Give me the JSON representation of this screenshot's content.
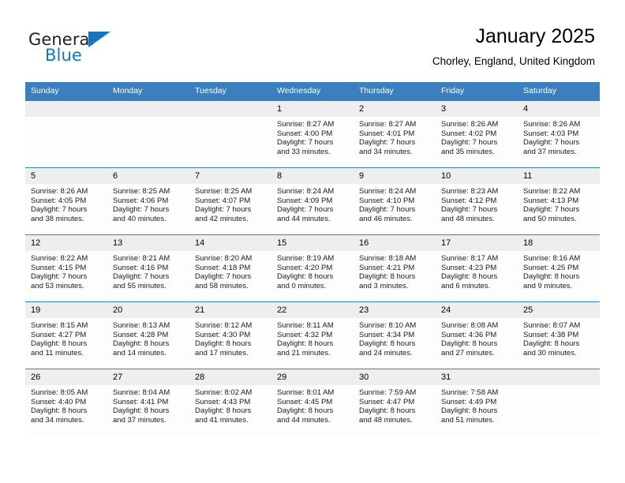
{
  "brand": {
    "name_part1": "General",
    "name_part2": "Blue",
    "triangle_color": "#1675bb"
  },
  "header": {
    "month_title": "January 2025",
    "location": "Chorley, England, United Kingdom",
    "header_bg": "#3b7fbf",
    "daynum_bg": "#eeeeee"
  },
  "weekdays": [
    "Sunday",
    "Monday",
    "Tuesday",
    "Wednesday",
    "Thursday",
    "Friday",
    "Saturday"
  ],
  "labels": {
    "sunrise_prefix": "Sunrise:",
    "sunset_prefix": "Sunset:",
    "daylight_prefix": "Daylight:"
  },
  "weeks": [
    [
      {
        "day": "",
        "empty": true
      },
      {
        "day": "",
        "empty": true
      },
      {
        "day": "",
        "empty": true
      },
      {
        "day": "1",
        "sunrise": "Sunrise: 8:27 AM",
        "sunset": "Sunset: 4:00 PM",
        "daylight_line1": "Daylight: 7 hours",
        "daylight_line2": "and 33 minutes."
      },
      {
        "day": "2",
        "sunrise": "Sunrise: 8:27 AM",
        "sunset": "Sunset: 4:01 PM",
        "daylight_line1": "Daylight: 7 hours",
        "daylight_line2": "and 34 minutes."
      },
      {
        "day": "3",
        "sunrise": "Sunrise: 8:26 AM",
        "sunset": "Sunset: 4:02 PM",
        "daylight_line1": "Daylight: 7 hours",
        "daylight_line2": "and 35 minutes."
      },
      {
        "day": "4",
        "sunrise": "Sunrise: 8:26 AM",
        "sunset": "Sunset: 4:03 PM",
        "daylight_line1": "Daylight: 7 hours",
        "daylight_line2": "and 37 minutes."
      }
    ],
    [
      {
        "day": "5",
        "sunrise": "Sunrise: 8:26 AM",
        "sunset": "Sunset: 4:05 PM",
        "daylight_line1": "Daylight: 7 hours",
        "daylight_line2": "and 38 minutes."
      },
      {
        "day": "6",
        "sunrise": "Sunrise: 8:25 AM",
        "sunset": "Sunset: 4:06 PM",
        "daylight_line1": "Daylight: 7 hours",
        "daylight_line2": "and 40 minutes."
      },
      {
        "day": "7",
        "sunrise": "Sunrise: 8:25 AM",
        "sunset": "Sunset: 4:07 PM",
        "daylight_line1": "Daylight: 7 hours",
        "daylight_line2": "and 42 minutes."
      },
      {
        "day": "8",
        "sunrise": "Sunrise: 8:24 AM",
        "sunset": "Sunset: 4:09 PM",
        "daylight_line1": "Daylight: 7 hours",
        "daylight_line2": "and 44 minutes."
      },
      {
        "day": "9",
        "sunrise": "Sunrise: 8:24 AM",
        "sunset": "Sunset: 4:10 PM",
        "daylight_line1": "Daylight: 7 hours",
        "daylight_line2": "and 46 minutes."
      },
      {
        "day": "10",
        "sunrise": "Sunrise: 8:23 AM",
        "sunset": "Sunset: 4:12 PM",
        "daylight_line1": "Daylight: 7 hours",
        "daylight_line2": "and 48 minutes."
      },
      {
        "day": "11",
        "sunrise": "Sunrise: 8:22 AM",
        "sunset": "Sunset: 4:13 PM",
        "daylight_line1": "Daylight: 7 hours",
        "daylight_line2": "and 50 minutes."
      }
    ],
    [
      {
        "day": "12",
        "sunrise": "Sunrise: 8:22 AM",
        "sunset": "Sunset: 4:15 PM",
        "daylight_line1": "Daylight: 7 hours",
        "daylight_line2": "and 53 minutes."
      },
      {
        "day": "13",
        "sunrise": "Sunrise: 8:21 AM",
        "sunset": "Sunset: 4:16 PM",
        "daylight_line1": "Daylight: 7 hours",
        "daylight_line2": "and 55 minutes."
      },
      {
        "day": "14",
        "sunrise": "Sunrise: 8:20 AM",
        "sunset": "Sunset: 4:18 PM",
        "daylight_line1": "Daylight: 7 hours",
        "daylight_line2": "and 58 minutes."
      },
      {
        "day": "15",
        "sunrise": "Sunrise: 8:19 AM",
        "sunset": "Sunset: 4:20 PM",
        "daylight_line1": "Daylight: 8 hours",
        "daylight_line2": "and 0 minutes."
      },
      {
        "day": "16",
        "sunrise": "Sunrise: 8:18 AM",
        "sunset": "Sunset: 4:21 PM",
        "daylight_line1": "Daylight: 8 hours",
        "daylight_line2": "and 3 minutes."
      },
      {
        "day": "17",
        "sunrise": "Sunrise: 8:17 AM",
        "sunset": "Sunset: 4:23 PM",
        "daylight_line1": "Daylight: 8 hours",
        "daylight_line2": "and 6 minutes."
      },
      {
        "day": "18",
        "sunrise": "Sunrise: 8:16 AM",
        "sunset": "Sunset: 4:25 PM",
        "daylight_line1": "Daylight: 8 hours",
        "daylight_line2": "and 9 minutes."
      }
    ],
    [
      {
        "day": "19",
        "sunrise": "Sunrise: 8:15 AM",
        "sunset": "Sunset: 4:27 PM",
        "daylight_line1": "Daylight: 8 hours",
        "daylight_line2": "and 11 minutes."
      },
      {
        "day": "20",
        "sunrise": "Sunrise: 8:13 AM",
        "sunset": "Sunset: 4:28 PM",
        "daylight_line1": "Daylight: 8 hours",
        "daylight_line2": "and 14 minutes."
      },
      {
        "day": "21",
        "sunrise": "Sunrise: 8:12 AM",
        "sunset": "Sunset: 4:30 PM",
        "daylight_line1": "Daylight: 8 hours",
        "daylight_line2": "and 17 minutes."
      },
      {
        "day": "22",
        "sunrise": "Sunrise: 8:11 AM",
        "sunset": "Sunset: 4:32 PM",
        "daylight_line1": "Daylight: 8 hours",
        "daylight_line2": "and 21 minutes."
      },
      {
        "day": "23",
        "sunrise": "Sunrise: 8:10 AM",
        "sunset": "Sunset: 4:34 PM",
        "daylight_line1": "Daylight: 8 hours",
        "daylight_line2": "and 24 minutes."
      },
      {
        "day": "24",
        "sunrise": "Sunrise: 8:08 AM",
        "sunset": "Sunset: 4:36 PM",
        "daylight_line1": "Daylight: 8 hours",
        "daylight_line2": "and 27 minutes."
      },
      {
        "day": "25",
        "sunrise": "Sunrise: 8:07 AM",
        "sunset": "Sunset: 4:38 PM",
        "daylight_line1": "Daylight: 8 hours",
        "daylight_line2": "and 30 minutes."
      }
    ],
    [
      {
        "day": "26",
        "sunrise": "Sunrise: 8:05 AM",
        "sunset": "Sunset: 4:40 PM",
        "daylight_line1": "Daylight: 8 hours",
        "daylight_line2": "and 34 minutes."
      },
      {
        "day": "27",
        "sunrise": "Sunrise: 8:04 AM",
        "sunset": "Sunset: 4:41 PM",
        "daylight_line1": "Daylight: 8 hours",
        "daylight_line2": "and 37 minutes."
      },
      {
        "day": "28",
        "sunrise": "Sunrise: 8:02 AM",
        "sunset": "Sunset: 4:43 PM",
        "daylight_line1": "Daylight: 8 hours",
        "daylight_line2": "and 41 minutes."
      },
      {
        "day": "29",
        "sunrise": "Sunrise: 8:01 AM",
        "sunset": "Sunset: 4:45 PM",
        "daylight_line1": "Daylight: 8 hours",
        "daylight_line2": "and 44 minutes."
      },
      {
        "day": "30",
        "sunrise": "Sunrise: 7:59 AM",
        "sunset": "Sunset: 4:47 PM",
        "daylight_line1": "Daylight: 8 hours",
        "daylight_line2": "and 48 minutes."
      },
      {
        "day": "31",
        "sunrise": "Sunrise: 7:58 AM",
        "sunset": "Sunset: 4:49 PM",
        "daylight_line1": "Daylight: 8 hours",
        "daylight_line2": "and 51 minutes."
      },
      {
        "day": "",
        "empty": true
      }
    ]
  ]
}
